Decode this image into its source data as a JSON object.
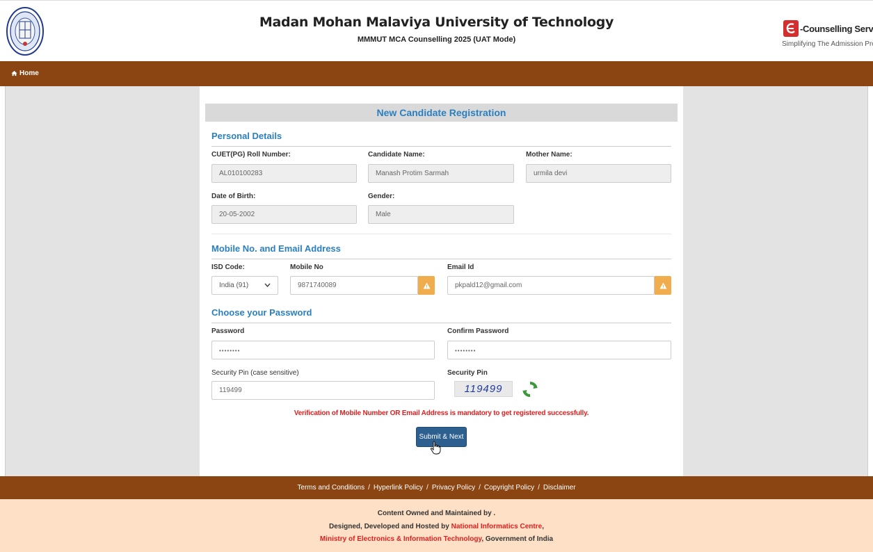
{
  "header": {
    "title": "Madan Mohan Malaviya University of Technology",
    "subtitle": "MMMUT MCA Counselling 2025 (UAT Mode)",
    "right_logo_text": "-Counselling Services",
    "right_logo_tagline": "Simplifying The Admission Process"
  },
  "nav": {
    "home_label": "Home"
  },
  "form": {
    "heading": "New Candidate Registration",
    "personal": {
      "title": "Personal Details",
      "roll_label": "CUET(PG) Roll Number:",
      "roll_value": "AL010100283",
      "name_label": "Candidate Name:",
      "name_value": "Manash Protim Sarmah",
      "mother_label": "Mother Name:",
      "mother_value": "urmila devi",
      "dob_label": "Date of Birth:",
      "dob_value": "20-05-2002",
      "gender_label": "Gender:",
      "gender_value": "Male"
    },
    "contact": {
      "title": "Mobile No. and Email Address",
      "isd_label": "ISD Code:",
      "isd_value": "India (91)",
      "mobile_label": "Mobile No",
      "mobile_value": "9871740089",
      "email_label": "Email Id",
      "email_value": "pkpald12@gmail.com"
    },
    "password": {
      "title": "Choose your Password",
      "password_label": "Password",
      "password_value": "••••••••",
      "confirm_label": "Confirm Password",
      "confirm_value": "••••••••",
      "pin_input_label": "Security Pin (case sensitive)",
      "pin_input_value": "119499",
      "pin_label": "Security Pin",
      "captcha_text": "119499"
    },
    "notice": "Verification of Mobile Number OR Email Address is mandatory to get registered successfully.",
    "submit_label": "Submit & Next"
  },
  "footer": {
    "links": [
      "Terms and Conditions",
      "Hyperlink Policy",
      "Privacy Policy",
      "Copyright Policy",
      "Disclaimer"
    ],
    "separator": "/",
    "line1": "Content Owned and Maintained by .",
    "line2_prefix": "Designed, Developed and Hosted by ",
    "line2_link": "National Informatics Centre",
    "line2_suffix": ",",
    "line3_link": "Ministry of Electronics & Information Technology",
    "line3_suffix": ", Government of India"
  },
  "colors": {
    "nav_brown": "#8a4513",
    "heading_blue": "#2a7fc1",
    "warning_orange": "#f0ad4e",
    "submit_blue": "#2d5f8f",
    "notice_red": "#e02020",
    "footer_peach": "#fde0c5"
  },
  "icons": [
    "university-seal-icon",
    "ec-logo-icon",
    "home-icon",
    "chevron-down-icon",
    "warning-icon",
    "refresh-icon",
    "hand-pointer-icon"
  ]
}
